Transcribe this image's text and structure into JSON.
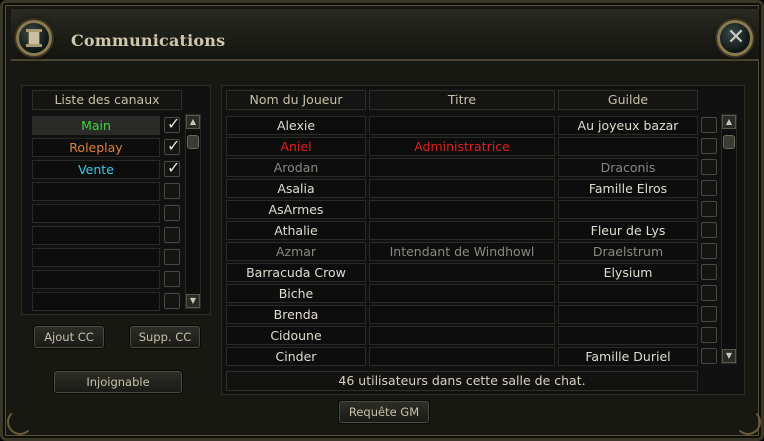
{
  "window": {
    "title": "Communications"
  },
  "colors": {
    "green": "#3ad63a",
    "orange": "#e0803a",
    "cyan": "#38c8e8",
    "red": "#e02020",
    "white": "#e0dcd0",
    "grey": "#8a8880"
  },
  "channels": {
    "header": "Liste des canaux",
    "items": [
      {
        "label": "Main",
        "color": "#3ad63a",
        "checked": true,
        "selected": true
      },
      {
        "label": "Roleplay",
        "color": "#e0803a",
        "checked": true,
        "selected": false
      },
      {
        "label": "Vente",
        "color": "#38c8e8",
        "checked": true,
        "selected": false
      },
      {
        "label": "",
        "color": "#e0dcd0",
        "checked": false,
        "selected": false
      },
      {
        "label": "",
        "color": "#e0dcd0",
        "checked": false,
        "selected": false
      },
      {
        "label": "",
        "color": "#e0dcd0",
        "checked": false,
        "selected": false
      },
      {
        "label": "",
        "color": "#e0dcd0",
        "checked": false,
        "selected": false
      },
      {
        "label": "",
        "color": "#e0dcd0",
        "checked": false,
        "selected": false
      },
      {
        "label": "",
        "color": "#e0dcd0",
        "checked": false,
        "selected": false
      }
    ],
    "add_button": "Ajout CC",
    "remove_button": "Supp. CC",
    "unreachable_button": "Injoignable"
  },
  "players": {
    "columns": [
      "Nom du Joueur",
      "Titre",
      "Guilde"
    ],
    "rows": [
      {
        "name": "Alexie",
        "title": "",
        "guild": "Au joyeux bazar",
        "color": "#e0dcd0"
      },
      {
        "name": "Aniel",
        "title": "Administratrice",
        "guild": "",
        "color": "#e02020"
      },
      {
        "name": "Arodan",
        "title": "",
        "guild": "Draconis",
        "color": "#8a8880"
      },
      {
        "name": "Asalia",
        "title": "",
        "guild": "Famille Elros",
        "color": "#e0dcd0"
      },
      {
        "name": "AsArmes",
        "title": "",
        "guild": "",
        "color": "#e0dcd0"
      },
      {
        "name": "Athalie",
        "title": "",
        "guild": "Fleur de Lys",
        "color": "#e0dcd0"
      },
      {
        "name": "Azmar",
        "title": "Intendant de Windhowl",
        "guild": "Draelstrum",
        "color": "#8a8880"
      },
      {
        "name": "Barracuda Crow",
        "title": "",
        "guild": "Elysium",
        "color": "#e0dcd0"
      },
      {
        "name": "Biche",
        "title": "",
        "guild": "",
        "color": "#e0dcd0"
      },
      {
        "name": "Brenda",
        "title": "",
        "guild": "",
        "color": "#e0dcd0"
      },
      {
        "name": "Cidoune",
        "title": "",
        "guild": "",
        "color": "#e0dcd0"
      },
      {
        "name": "Cinder",
        "title": "",
        "guild": "Famille Duriel",
        "color": "#e0dcd0"
      }
    ],
    "status": "46 utilisateurs dans cette salle de chat."
  },
  "gm_button": "Requête GM",
  "icons": {
    "window_icon": "scroll-icon",
    "close": "close-icon",
    "scroll_up": "chevron-up-icon",
    "scroll_down": "chevron-down-icon"
  }
}
